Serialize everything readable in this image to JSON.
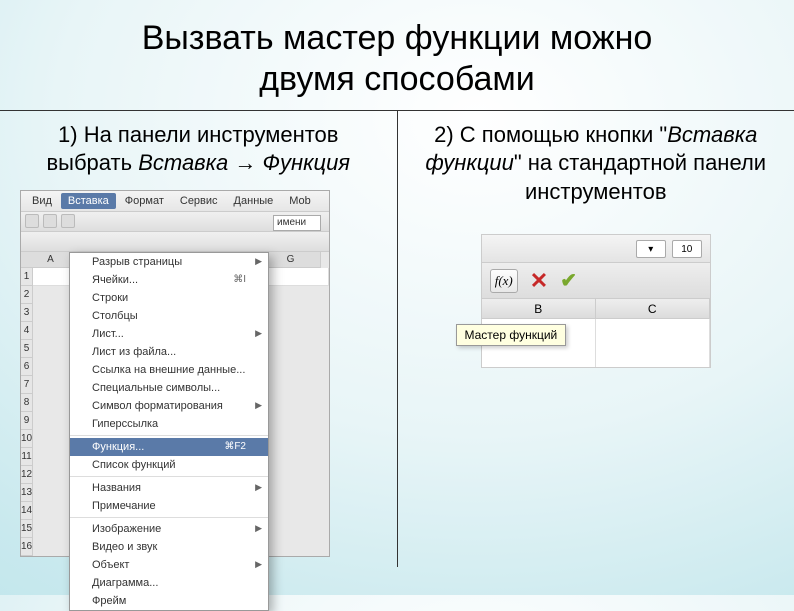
{
  "title_l1": "Вызвать мастер функции можно",
  "title_l2": "двумя способами",
  "left": {
    "desc_a": "1) На панели инструментов выбрать ",
    "desc_b": "Вставка → Функция",
    "menubar": [
      "Вид",
      "Вставка",
      "Формат",
      "Сервис",
      "Данные",
      "Mob"
    ],
    "namebox": "имени",
    "cols": [
      "A",
      "G"
    ],
    "menu": {
      "items": [
        {
          "label": "Разрыв страницы",
          "arrow": true
        },
        {
          "label": "Ячейки...",
          "shortcut": "⌘I"
        },
        {
          "label": "Строки"
        },
        {
          "label": "Столбцы"
        },
        {
          "label": "Лист...",
          "arrow": true
        },
        {
          "label": "Лист из файла..."
        },
        {
          "label": "Ссылка на внешние данные..."
        },
        {
          "label": "Специальные символы..."
        },
        {
          "label": "Символ форматирования",
          "arrow": true
        },
        {
          "label": "Гиперссылка"
        }
      ],
      "hl": {
        "label": "Функция...",
        "shortcut": "⌘F2"
      },
      "items2": [
        {
          "label": "Список функций"
        }
      ],
      "items3": [
        {
          "label": "Названия",
          "arrow": true
        },
        {
          "label": "Примечание"
        }
      ],
      "items4": [
        {
          "label": "Изображение",
          "arrow": true
        },
        {
          "label": "Видео и звук"
        },
        {
          "label": "Объект",
          "arrow": true
        },
        {
          "label": "Диаграмма..."
        },
        {
          "label": "Фрейм"
        }
      ]
    }
  },
  "right": {
    "desc_a": "2) С помощью кнопки \"",
    "desc_b": "Вставка функции",
    "desc_c": "\" на стандартной панели инструментов",
    "fx": "f(x)",
    "topval": "10",
    "cols": [
      "B",
      "C"
    ],
    "tooltip": "Мастер функций"
  }
}
